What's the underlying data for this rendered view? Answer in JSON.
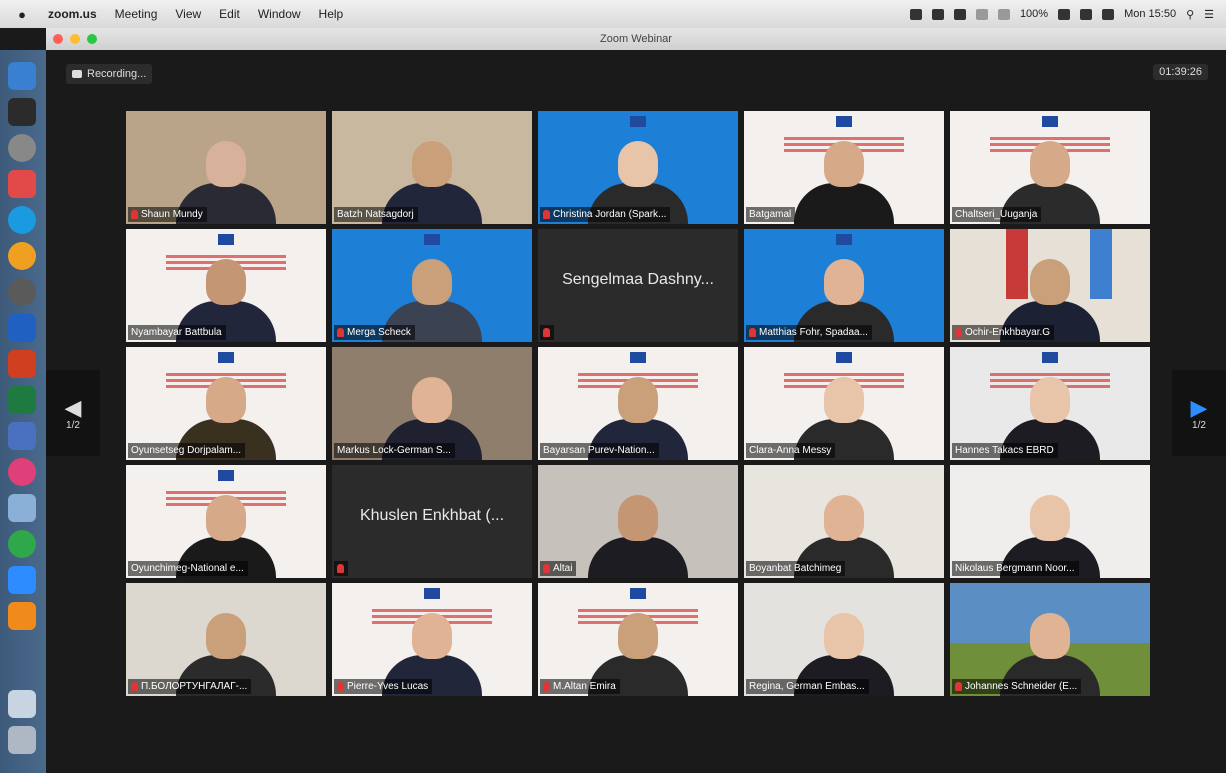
{
  "menubar": {
    "app_name": "zoom.us",
    "items": [
      "Meeting",
      "View",
      "Edit",
      "Window",
      "Help"
    ],
    "battery": "100%",
    "clock": "Mon 15:50"
  },
  "window": {
    "title": "Zoom Webinar",
    "recording_label": "Recording...",
    "timer": "01:39:26",
    "prev_page": "1/2",
    "next_page": "1/2"
  },
  "participants": [
    {
      "name": "Shaun Mundy",
      "muted": true,
      "video": true,
      "bg": "#b9a48a",
      "skin": "#d8b19a",
      "suit": "#2a2a35"
    },
    {
      "name": "Batzh Natsagdorj",
      "muted": false,
      "video": true,
      "active": true,
      "bg": "#c8b8a0",
      "skin": "#c9a07a",
      "suit": "#22263a"
    },
    {
      "name": "Christina Jordan (Spark...",
      "muted": true,
      "video": true,
      "bg": "#1d7fd6",
      "skin": "#e8c4a8",
      "suit": "#2a2a2a",
      "poster": "blue"
    },
    {
      "name": "Batgamal",
      "muted": false,
      "video": true,
      "bg": "#f4f0ee",
      "skin": "#d6a989",
      "suit": "#1a1a1a",
      "poster": "white"
    },
    {
      "name": "Chaltseri_Uuganja",
      "muted": false,
      "video": true,
      "bg": "#f4f0ee",
      "skin": "#d6a989",
      "suit": "#2b2b2b",
      "poster": "white"
    },
    {
      "name": "Nyambayar Battbula",
      "muted": false,
      "video": true,
      "bg": "#f4f0ee",
      "skin": "#c49674",
      "suit": "#22263a",
      "poster": "white"
    },
    {
      "name": "Merga Scheck",
      "muted": true,
      "video": true,
      "bg": "#1d7fd6",
      "skin": "#c9a07a",
      "suit": "#3b4252",
      "poster": "blue"
    },
    {
      "name": "Sengelmaa Dashny...",
      "muted": true,
      "video": false,
      "bg": "#2b2b2b"
    },
    {
      "name": "Matthias Fohr, Spadaa...",
      "muted": true,
      "video": true,
      "bg": "#1d7fd6",
      "skin": "#e0b394",
      "suit": "#2a2a2a",
      "poster": "blue"
    },
    {
      "name": "Ochir-Enkhbayar.G",
      "muted": true,
      "video": true,
      "bg": "#e6e0d6",
      "skin": "#c9a07a",
      "suit": "#1c2233",
      "poster": "flags"
    },
    {
      "name": "Oyunsetseg Dorjpalam...",
      "muted": false,
      "video": true,
      "bg": "#f4f0ee",
      "skin": "#d6a989",
      "suit": "#3a3020",
      "poster": "white"
    },
    {
      "name": "Markus Lock-German S...",
      "muted": false,
      "video": true,
      "bg": "#8f7e6b",
      "skin": "#e0b394",
      "suit": "#1f2030"
    },
    {
      "name": "Bayarsan Purev-Nation...",
      "muted": false,
      "video": true,
      "bg": "#f4f0ee",
      "skin": "#c9a07a",
      "suit": "#22263a",
      "poster": "white"
    },
    {
      "name": "Clara-Anna Messy",
      "muted": false,
      "video": true,
      "bg": "#f4f0ee",
      "skin": "#e8c4a8",
      "suit": "#2a2a2a",
      "poster": "white"
    },
    {
      "name": "Hannes Takacs EBRD",
      "muted": false,
      "video": true,
      "bg": "#e9e9ea",
      "skin": "#e8c4a8",
      "suit": "#1c1c22",
      "poster": "white"
    },
    {
      "name": "Oyunchimeg-National e...",
      "muted": false,
      "video": true,
      "bg": "#f4f0ee",
      "skin": "#d6a989",
      "suit": "#1a1a1a",
      "poster": "white"
    },
    {
      "name": "Khuslen Enkhbat (...",
      "muted": true,
      "video": false,
      "bg": "#2b2b2b"
    },
    {
      "name": "Altai",
      "muted": true,
      "video": true,
      "bg": "#c6c2bb",
      "skin": "#c49674",
      "suit": "#1c1c22"
    },
    {
      "name": "Boyanbat Batchimeg",
      "muted": false,
      "video": true,
      "bg": "#e8e4de",
      "skin": "#e0b394",
      "suit": "#2a2a2a"
    },
    {
      "name": "Nikolaus Bergmann Noor...",
      "muted": false,
      "video": true,
      "bg": "#efeeec",
      "skin": "#e8c4a8",
      "suit": "#1c1c22"
    },
    {
      "name": "П.БОЛОРТУНГАЛАГ-...",
      "muted": true,
      "video": true,
      "bg": "#dcd8d0",
      "skin": "#c9a07a",
      "suit": "#2b2b2b"
    },
    {
      "name": "Pierre-Yves Lucas",
      "muted": true,
      "video": true,
      "bg": "#f4f0ee",
      "skin": "#e0b394",
      "suit": "#22263a",
      "poster": "white"
    },
    {
      "name": "M.Altan Emira",
      "muted": true,
      "video": true,
      "bg": "#f4f0ee",
      "skin": "#c9a07a",
      "suit": "#2a2a2a",
      "poster": "white"
    },
    {
      "name": "Regina, German Embas...",
      "muted": false,
      "video": true,
      "bg": "#e4e2de",
      "skin": "#e8c4a8",
      "suit": "#1c1c22"
    },
    {
      "name": "Johannes Schneider (E...",
      "muted": true,
      "video": true,
      "bg": "#5b8fc4",
      "skin": "#e0b394",
      "suit": "#2a2a2a",
      "poster": "landscape"
    }
  ]
}
